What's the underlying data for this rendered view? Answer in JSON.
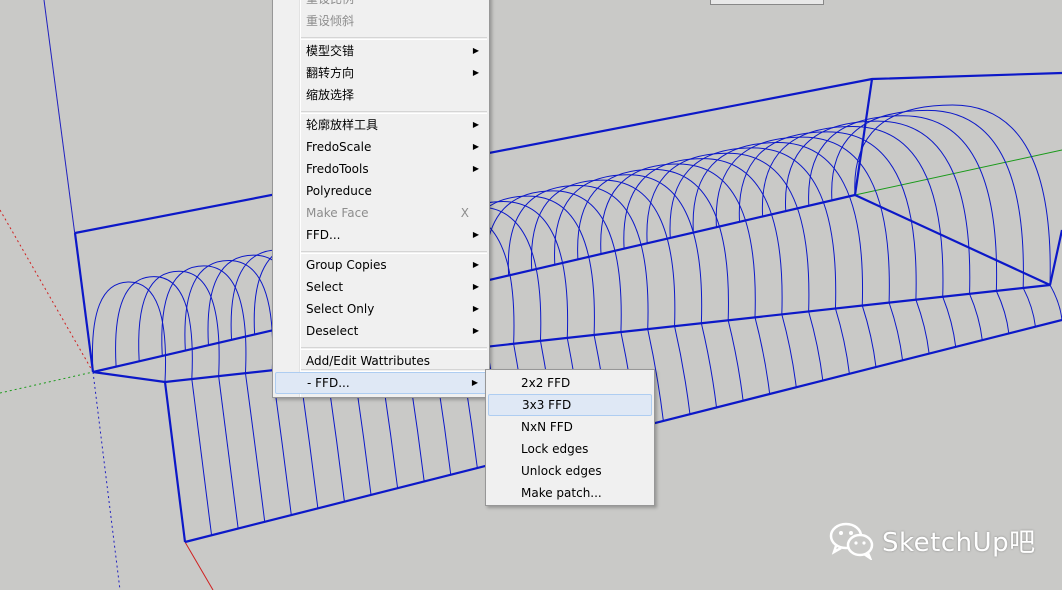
{
  "context_menu": {
    "items": [
      {
        "label": "重设比例",
        "state": "disabled",
        "arrow": false
      },
      {
        "label": "重设倾斜",
        "state": "disabled",
        "arrow": false
      },
      {
        "label": "模型交错",
        "arrow": true
      },
      {
        "label": "翻转方向",
        "arrow": true
      },
      {
        "label": "缩放选择",
        "arrow": false
      },
      {
        "label": "轮廓放样工具",
        "arrow": true
      },
      {
        "label": "FredoScale",
        "arrow": true
      },
      {
        "label": "FredoTools",
        "arrow": true
      },
      {
        "label": "Polyreduce",
        "arrow": false
      },
      {
        "label": "Make Face",
        "state": "disabled",
        "shortcut": "X",
        "arrow": false
      },
      {
        "label": "FFD...",
        "arrow": true
      },
      {
        "label": "Group Copies",
        "arrow": true
      },
      {
        "label": "Select",
        "arrow": true
      },
      {
        "label": "Select Only",
        "arrow": true
      },
      {
        "label": "Deselect",
        "arrow": true
      },
      {
        "label": "Add/Edit Wattributes",
        "arrow": false
      },
      {
        "label": "- FFD...",
        "arrow": true,
        "state": "highlighted"
      }
    ],
    "arrow_glyph": "▶"
  },
  "submenu": {
    "items": [
      {
        "label": "2x2 FFD"
      },
      {
        "label": "3x3 FFD",
        "state": "highlighted"
      },
      {
        "label": "NxN FFD"
      },
      {
        "label": "Lock edges"
      },
      {
        "label": "Unlock edges"
      },
      {
        "label": "Make patch..."
      }
    ]
  },
  "watermark": {
    "text": "SketchUp吧",
    "icon": "wechat-icon"
  },
  "colors": {
    "viewport_bg": "#c9c9c7",
    "wireframe": "#0c18c8",
    "axis_red": "#d02020",
    "axis_green": "#1a9a1a",
    "axis_blue": "#2020c0",
    "menu_bg": "#f0f0f0",
    "highlight": "#dfe8f5"
  }
}
